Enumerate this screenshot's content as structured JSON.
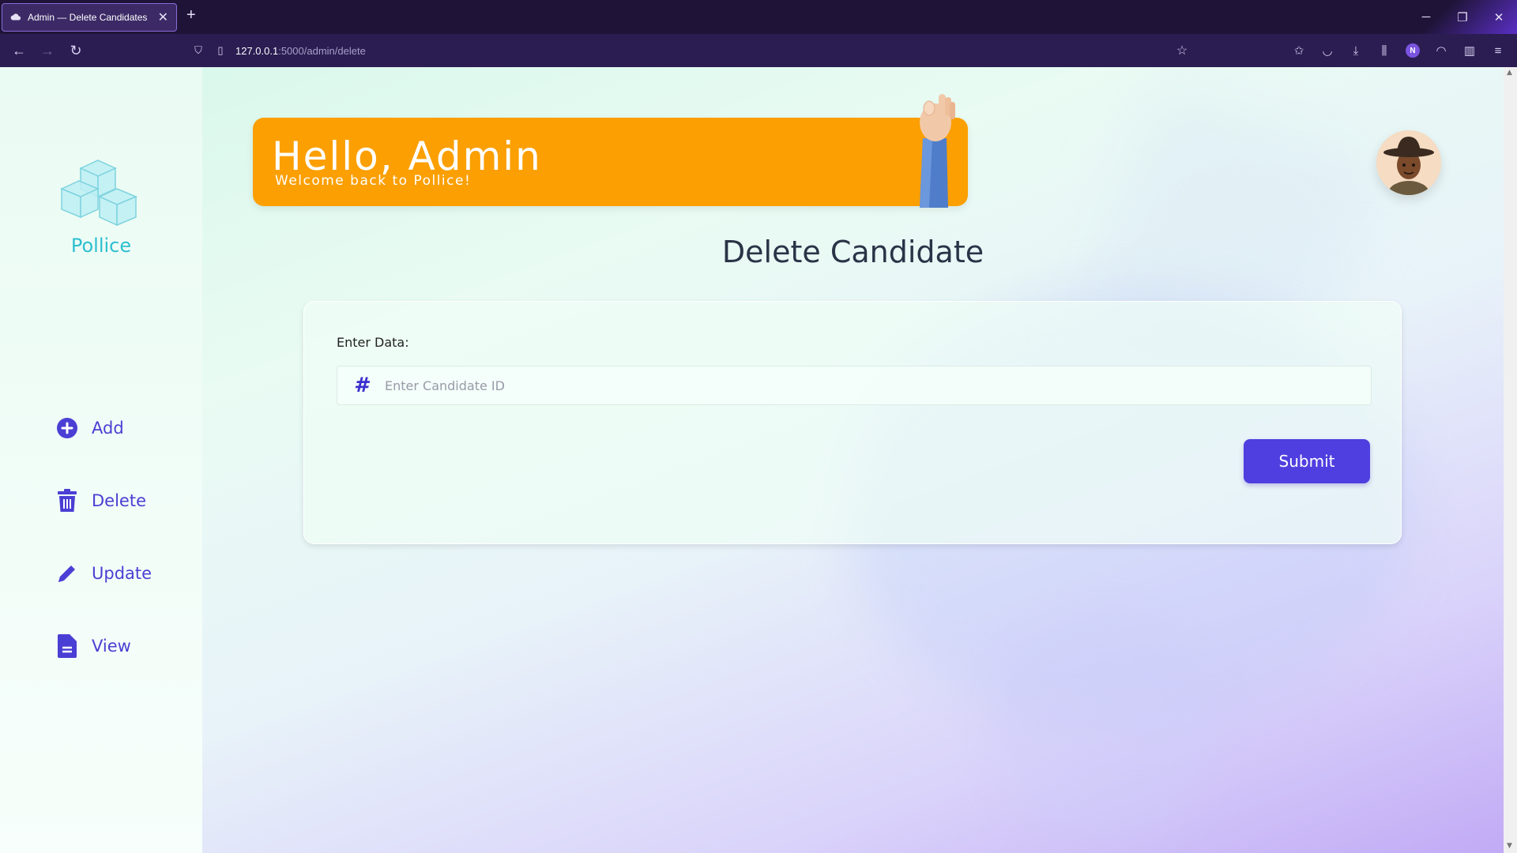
{
  "browser": {
    "tab_title": "Admin — Delete Candidates",
    "new_tab": "+",
    "url_host": "127.0.0.1",
    "url_path": ":5000/admin/delete",
    "profile_letter": "N"
  },
  "sidebar": {
    "brand": "Pollice",
    "items": [
      {
        "label": "Add",
        "icon": "plus-circle-icon"
      },
      {
        "label": "Delete",
        "icon": "trash-icon"
      },
      {
        "label": "Update",
        "icon": "pencil-icon"
      },
      {
        "label": "View",
        "icon": "document-icon"
      }
    ]
  },
  "hero": {
    "title": "Hello, Admin",
    "subtitle": "Welcome back to Pollice!"
  },
  "main": {
    "heading": "Delete Candidate",
    "form": {
      "label": "Enter Data:",
      "input_icon": "#",
      "placeholder": "Enter Candidate ID",
      "value": "",
      "submit_label": "Submit"
    }
  },
  "colors": {
    "accent": "#4f3fe0",
    "brand": "#2dbfcf",
    "hero": "#fb9f02",
    "browser_bg": "#1f1438"
  }
}
